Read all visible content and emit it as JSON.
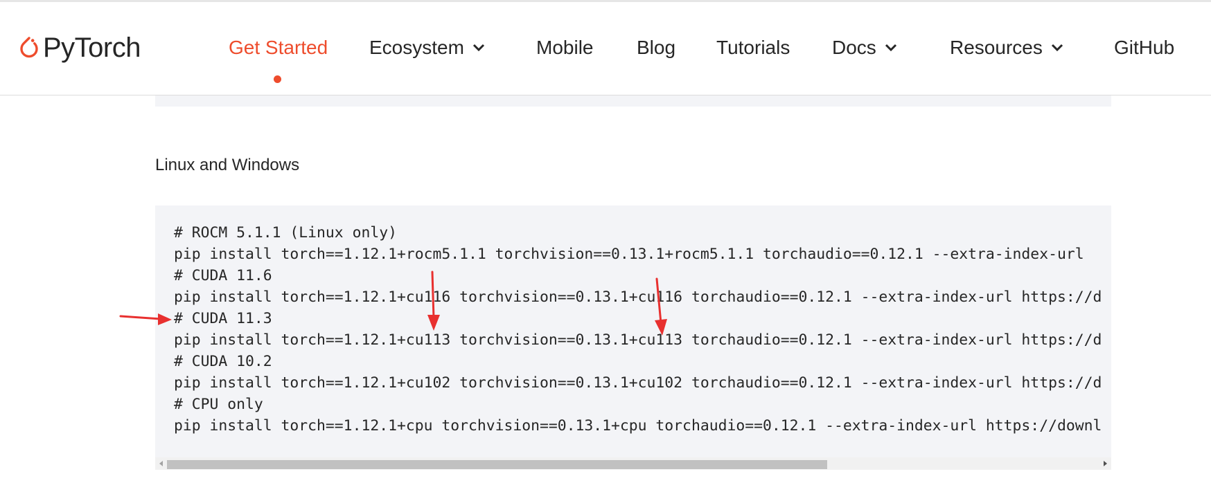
{
  "header": {
    "logo_text": "PyTorch",
    "nav": [
      {
        "label": "Get Started",
        "active": true,
        "dropdown": false
      },
      {
        "label": "Ecosystem",
        "dropdown": true
      },
      {
        "label": "Mobile",
        "dropdown": false
      },
      {
        "label": "Blog",
        "dropdown": false
      },
      {
        "label": "Tutorials",
        "dropdown": false
      },
      {
        "label": "Docs",
        "dropdown": true
      },
      {
        "label": "Resources",
        "dropdown": true
      },
      {
        "label": "GitHub",
        "dropdown": false
      }
    ]
  },
  "section": {
    "heading": "Linux and Windows"
  },
  "code": {
    "lines": [
      "# ROCM 5.1.1 (Linux only)",
      "pip install torch==1.12.1+rocm5.1.1 torchvision==0.13.1+rocm5.1.1 torchaudio==0.12.1 --extra-index-url",
      "# CUDA 11.6",
      "pip install torch==1.12.1+cu116 torchvision==0.13.1+cu116 torchaudio==0.12.1 --extra-index-url https://d",
      "# CUDA 11.3",
      "pip install torch==1.12.1+cu113 torchvision==0.13.1+cu113 torchaudio==0.12.1 --extra-index-url https://d",
      "# CUDA 10.2",
      "pip install torch==1.12.1+cu102 torchvision==0.13.1+cu102 torchaudio==0.12.1 --extra-index-url https://d",
      "# CPU only",
      "pip install torch==1.12.1+cpu torchvision==0.13.1+cpu torchaudio==0.12.1 --extra-index-url https://downl"
    ]
  },
  "colors": {
    "accent": "#ee4c2c",
    "annotation_arrow": "#e8302f",
    "code_background": "#f3f4f7"
  },
  "icons": [
    "pytorch-flame-icon",
    "chevron-down-icon",
    "annotation-arrow-icon"
  ]
}
